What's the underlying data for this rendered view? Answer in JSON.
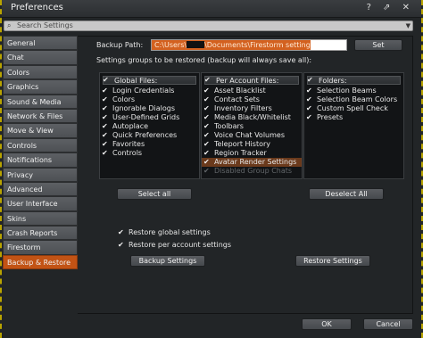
{
  "window": {
    "title": "Preferences",
    "title_icons": "? ⇗ ✕"
  },
  "search": {
    "placeholder": "Search Settings"
  },
  "sidebar": {
    "items": [
      {
        "label": "General"
      },
      {
        "label": "Chat"
      },
      {
        "label": "Colors"
      },
      {
        "label": "Graphics"
      },
      {
        "label": "Sound & Media"
      },
      {
        "label": "Network & Files"
      },
      {
        "label": "Move & View"
      },
      {
        "label": "Controls"
      },
      {
        "label": "Notifications"
      },
      {
        "label": "Privacy"
      },
      {
        "label": "Advanced"
      },
      {
        "label": "User Interface"
      },
      {
        "label": "Skins"
      },
      {
        "label": "Crash Reports"
      },
      {
        "label": "Firestorm"
      },
      {
        "label": "Backup & Restore",
        "active": true
      }
    ]
  },
  "backup": {
    "path_label": "Backup Path:",
    "path_prefix": "C:\\Users\\",
    "path_suffix": "\\Documents\\Firestorm settings",
    "set_button": "Set",
    "groups_label": "Settings groups to be restored (backup will always save all):"
  },
  "lists": {
    "global": {
      "header": "Global Files:",
      "items": [
        "Login Credentials",
        "Colors",
        "Ignorable Dialogs",
        "User-Defined Grids",
        "Autoplace",
        "Quick Preferences",
        "Favorites",
        "Controls"
      ]
    },
    "account": {
      "header": "Per Account Files:",
      "items": [
        "Asset Blacklist",
        "Contact Sets",
        "Inventory Filters",
        "Media Black/Whitelist",
        "Toolbars",
        "Voice Chat Volumes",
        "Teleport History",
        "Region Tracker",
        "Avatar Render Settings"
      ],
      "disabled_item": "Disabled Group Chats"
    },
    "folders": {
      "header": "Folders:",
      "items": [
        "Selection Beams",
        "Selection Beam Colors",
        "Custom Spell Check",
        "Presets"
      ]
    }
  },
  "actions": {
    "select_all": "Select all",
    "deselect_all": "Deselect All",
    "restore_global": "Restore global settings",
    "restore_account": "Restore per account settings",
    "backup_settings": "Backup Settings",
    "restore_settings": "Restore Settings"
  },
  "footer": {
    "ok": "OK",
    "cancel": "Cancel"
  },
  "colors": {
    "accent": "#c25315",
    "panel": "#222527",
    "list_bg": "#121416"
  }
}
